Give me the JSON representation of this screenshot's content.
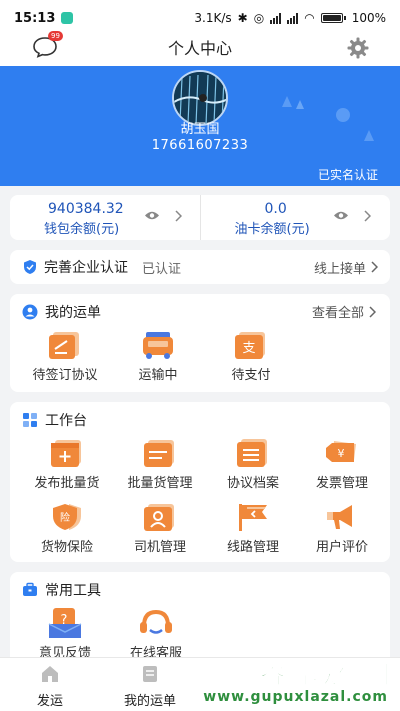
{
  "status_bar": {
    "time": "15:13",
    "speed": "3.1K/s",
    "battery": "100%"
  },
  "header": {
    "title": "个人中心",
    "message_badge": "99"
  },
  "profile": {
    "name": "胡玉国",
    "phone": "17661607233",
    "verified_label": "已实名认证"
  },
  "balances": [
    {
      "value": "940384.32",
      "label": "钱包余额(元)"
    },
    {
      "value": "0.0",
      "label": "油卡余额(元)"
    }
  ],
  "auth": {
    "title": "完善企业认证",
    "status": "已认证",
    "link": "线上接单"
  },
  "waybill": {
    "title": "我的运单",
    "link": "查看全部",
    "items": [
      {
        "label": "待签订协议",
        "icon": "sign-agreement-icon"
      },
      {
        "label": "运输中",
        "icon": "truck-icon"
      },
      {
        "label": "待支付",
        "icon": "pay-icon"
      }
    ]
  },
  "workbench": {
    "title": "工作台",
    "items": [
      {
        "label": "发布批量货",
        "icon": "publish-cargo-icon"
      },
      {
        "label": "批量货管理",
        "icon": "cargo-manage-icon"
      },
      {
        "label": "协议档案",
        "icon": "agreement-archive-icon"
      },
      {
        "label": "发票管理",
        "icon": "invoice-icon"
      },
      {
        "label": "货物保险",
        "icon": "insurance-icon"
      },
      {
        "label": "司机管理",
        "icon": "driver-icon"
      },
      {
        "label": "线路管理",
        "icon": "route-flag-icon"
      },
      {
        "label": "用户评价",
        "icon": "megaphone-icon"
      }
    ]
  },
  "tools": {
    "title": "常用工具",
    "items": [
      {
        "label": "意见反馈",
        "icon": "feedback-icon"
      },
      {
        "label": "在线客服",
        "icon": "headset-icon"
      }
    ]
  },
  "tabbar": [
    {
      "label": "发运",
      "icon": "home-icon"
    },
    {
      "label": "我的运单",
      "icon": "waybill-icon"
    }
  ],
  "watermark": {
    "brand": "谷普软件园",
    "url": "www.gupuxlazal.com"
  },
  "colors": {
    "primary": "#2f7ef0",
    "orange": "#f0883a",
    "balance_text": "#2055b8"
  }
}
